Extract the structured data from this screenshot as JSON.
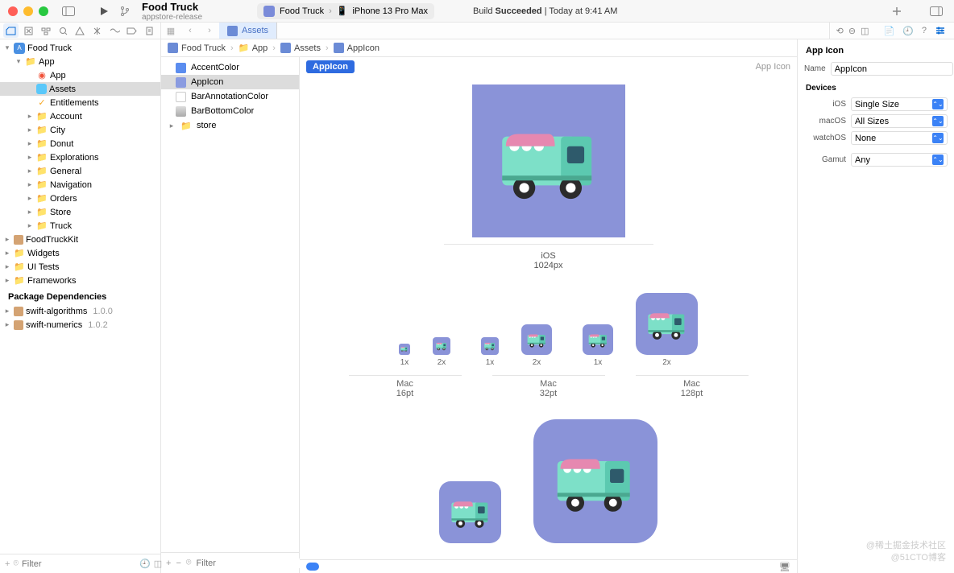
{
  "titlebar": {
    "project": "Food Truck",
    "subtitle": "appstore-release",
    "scheme": "Food Truck",
    "device": "iPhone 13 Pro Max",
    "build_prefix": "Build ",
    "build_status": "Succeeded",
    "build_suffix": " | Today at 9:41 AM"
  },
  "tabs": {
    "assets_tab": "Assets"
  },
  "crumbs": {
    "c0": "Food Truck",
    "c1": "App",
    "c2": "Assets",
    "c3": "AppIcon"
  },
  "navigator": {
    "root": "Food Truck",
    "app_group": "App",
    "app_swift": "App",
    "assets": "Assets",
    "entitlements": "Entitlements",
    "folders": [
      "Account",
      "City",
      "Donut",
      "Explorations",
      "General",
      "Navigation",
      "Orders",
      "Store",
      "Truck"
    ],
    "kit": "FoodTruckKit",
    "widgets": "Widgets",
    "uitests": "UI Tests",
    "frameworks": "Frameworks",
    "pkg_header": "Package Dependencies",
    "pkgs": [
      {
        "name": "swift-algorithms",
        "ver": "1.0.0"
      },
      {
        "name": "swift-numerics",
        "ver": "1.0.2"
      }
    ],
    "filter_placeholder": "Filter"
  },
  "asset_list": {
    "items": [
      {
        "name": "AccentColor",
        "sw": "accent"
      },
      {
        "name": "AppIcon",
        "sw": "icon",
        "selected": true
      },
      {
        "name": "BarAnnotationColor",
        "sw": "plain"
      },
      {
        "name": "BarBottomColor",
        "sw": "grad"
      }
    ],
    "store": "store",
    "filter_placeholder": "Filter"
  },
  "canvas": {
    "chip": "AppIcon",
    "rt": "App Icon",
    "ios_label": "iOS",
    "ios_size": "1024px",
    "scale_1x": "1x",
    "scale_2x": "2x",
    "mac_label": "Mac",
    "mac_16": "16pt",
    "mac_32": "32pt",
    "mac_128": "128pt"
  },
  "inspector": {
    "head": "App Icon",
    "name_label": "Name",
    "name_value": "AppIcon",
    "devices_head": "Devices",
    "rows": [
      {
        "label": "iOS",
        "value": "Single Size"
      },
      {
        "label": "macOS",
        "value": "All Sizes"
      },
      {
        "label": "watchOS",
        "value": "None"
      }
    ],
    "gamut_label": "Gamut",
    "gamut_value": "Any"
  },
  "watermark1": "@稀土掘金技术社区",
  "watermark2": "@51CTO博客"
}
